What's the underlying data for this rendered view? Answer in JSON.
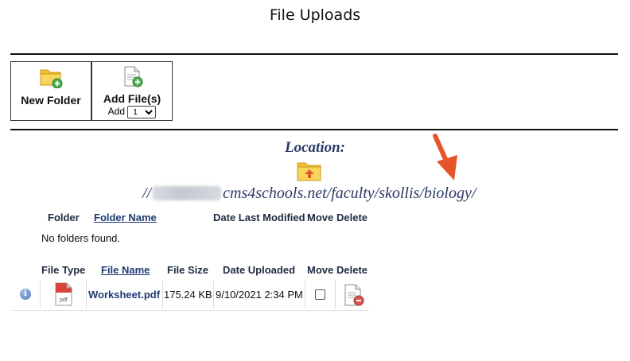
{
  "page": {
    "title": "File Uploads"
  },
  "toolbar": {
    "new_folder_label": "New Folder",
    "add_files_label": "Add File(s)",
    "add_count_label": "Add",
    "add_count_value": "1"
  },
  "location": {
    "heading": "Location:",
    "path_prefix": "//",
    "path_main": "cms4schools.net/faculty/skollis/",
    "path_highlight": "biology",
    "path_suffix": "/"
  },
  "folders": {
    "headers": {
      "folder": "Folder",
      "folder_name": "Folder Name",
      "date_modified": "Date Last Modified",
      "move": "Move",
      "delete": "Delete"
    },
    "empty_message": "No folders found."
  },
  "files": {
    "headers": {
      "file_type": "File Type",
      "file_name": "File Name",
      "file_size": "File Size",
      "date_uploaded": "Date Uploaded",
      "move": "Move",
      "delete": "Delete"
    },
    "rows": [
      {
        "type_label": "pdf",
        "name": "Worksheet.pdf",
        "size": "175.24 KB",
        "date": "9/10/2021 2:34 PM",
        "move_checked": false
      }
    ]
  },
  "icons": {
    "folder": "folder-add-icon",
    "file": "file-add-icon",
    "location": "folder-up-icon",
    "info": "info-icon",
    "pdf": "pdf-file-icon",
    "delete": "file-delete-icon",
    "annotation": "orange-arrow"
  },
  "colors": {
    "location_text": "#2b3a66",
    "link": "#1f3a70",
    "annotation_arrow": "#e8542a",
    "folder_yellow": "#f5c93a",
    "add_green": "#4caf50",
    "delete_red": "#d9534f"
  }
}
